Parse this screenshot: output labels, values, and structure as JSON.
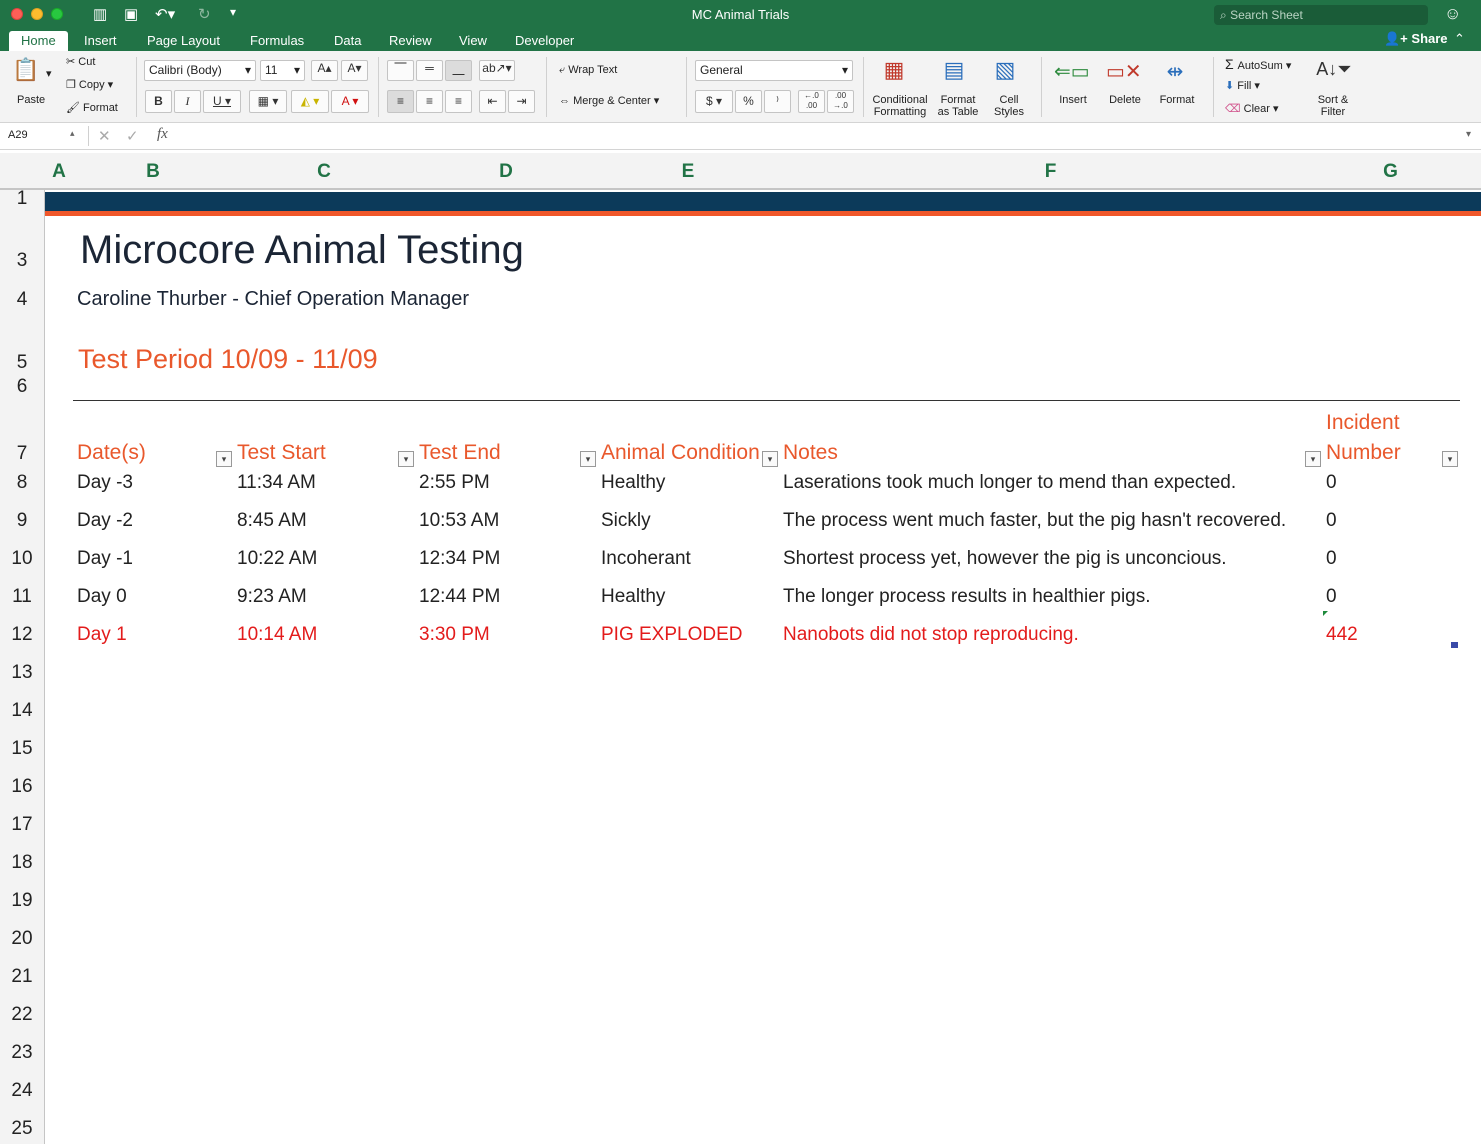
{
  "window": {
    "title": "MC Animal Trials",
    "search_placeholder": "Search Sheet",
    "share_label": "Share"
  },
  "tabs": [
    "Home",
    "Insert",
    "Page Layout",
    "Formulas",
    "Data",
    "Review",
    "View",
    "Developer"
  ],
  "ribbon": {
    "paste": "Paste",
    "cut": "Cut",
    "copy": "Copy",
    "format_painter": "Format",
    "font_name": "Calibri (Body)",
    "font_size": "11",
    "wrap_text": "Wrap Text",
    "merge_center": "Merge & Center",
    "number_format": "General",
    "conditional_formatting": [
      "Conditional",
      "Formatting"
    ],
    "format_as_table": [
      "Format",
      "as Table"
    ],
    "cell_styles": [
      "Cell",
      "Styles"
    ],
    "insert": "Insert",
    "delete": "Delete",
    "format": "Format",
    "autosum": "AutoSum",
    "fill": "Fill",
    "clear": "Clear",
    "sort_filter": [
      "Sort &",
      "Filter"
    ]
  },
  "formula_bar": {
    "name_box": "A29",
    "fx": "fx",
    "formula": ""
  },
  "columns": [
    "A",
    "B",
    "C",
    "D",
    "E",
    "F",
    "G"
  ],
  "rows": [
    "1",
    "3",
    "4",
    "5",
    "6",
    "7",
    "8",
    "9",
    "10",
    "11",
    "12",
    "13",
    "14",
    "15",
    "16",
    "17",
    "18",
    "19",
    "20",
    "21",
    "22",
    "23",
    "24",
    "25"
  ],
  "sheet": {
    "title": "Microcore Animal Testing",
    "subtitle": "Caroline Thurber - Chief Operation Manager",
    "period": "Test Period 10/09 - 11/09",
    "headers": {
      "dates": "Date(s)",
      "test_start": "Test Start",
      "test_end": "Test End",
      "condition": "Animal Condition",
      "notes": "Notes",
      "incident_line1": "Incident",
      "incident_line2": "Number"
    },
    "data_rows": [
      {
        "date": "Day -3",
        "start": "11:34 AM",
        "end": "2:55 PM",
        "condition": "Healthy",
        "notes": "Laserations took much longer to mend than expected.",
        "incident": "0"
      },
      {
        "date": "Day -2",
        "start": "8:45 AM",
        "end": "10:53 AM",
        "condition": "Sickly",
        "notes": "The process went much faster, but the pig hasn't recovered.",
        "incident": "0"
      },
      {
        "date": "Day -1",
        "start": "10:22 AM",
        "end": "12:34 PM",
        "condition": "Incoherant",
        "notes": "Shortest process yet, however the pig is unconcious.",
        "incident": "0"
      },
      {
        "date": "Day 0",
        "start": "9:23 AM",
        "end": "12:44 PM",
        "condition": "Healthy",
        "notes": "The longer process results in healthier pigs.",
        "incident": "0"
      },
      {
        "date": "Day 1",
        "start": "10:14 AM",
        "end": "3:30 PM",
        "condition": "PIG EXPLODED",
        "notes": "Nanobots did not stop reproducing.",
        "incident": "442"
      }
    ]
  },
  "colors": {
    "excel_green": "#217346",
    "navy_band": "#0c3a5a",
    "orange_accent": "#e9582c",
    "alert_red": "#e31b1b"
  }
}
